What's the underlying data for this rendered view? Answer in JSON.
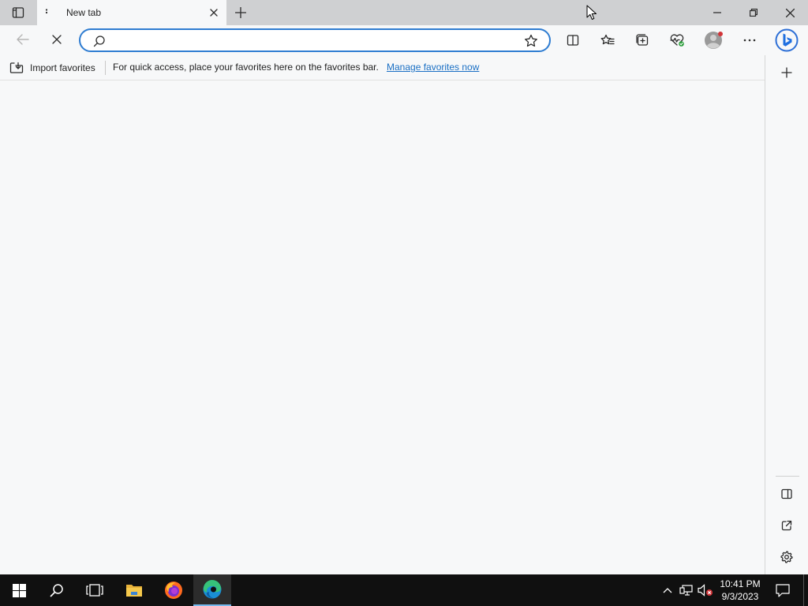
{
  "tab": {
    "title": "New tab"
  },
  "address_bar": {
    "value": "",
    "placeholder": ""
  },
  "favorites_bar": {
    "import_label": "Import favorites",
    "message": "For quick access, place your favorites here on the favorites bar.",
    "manage_link": "Manage favorites now"
  },
  "taskbar": {
    "time": "10:41 PM",
    "date": "9/3/2023"
  },
  "colors": {
    "accent": "#2e7cd1",
    "link": "#1a6fc4",
    "titlebar": "#cfd0d2",
    "taskbar": "#101010"
  },
  "icons": [
    "tab-actions-icon",
    "tab-menu-icon",
    "close-icon",
    "plus-icon",
    "minimize-icon",
    "restore-icon",
    "window-close-icon",
    "back-arrow-icon",
    "stop-icon",
    "search-icon",
    "star-icon",
    "split-screen-icon",
    "favorites-icon",
    "collections-icon",
    "performance-icon",
    "avatar",
    "more-icon",
    "bing-icon",
    "import-icon",
    "sidebar-plus-icon",
    "hide-sidebar-icon",
    "external-link-icon",
    "gear-icon",
    "windows-icon",
    "taskbar-search-icon",
    "task-view-icon",
    "folder-icon",
    "firefox-icon",
    "edge-icon",
    "chevron-up-icon",
    "network-icon",
    "volume-muted-icon",
    "notification-icon"
  ]
}
